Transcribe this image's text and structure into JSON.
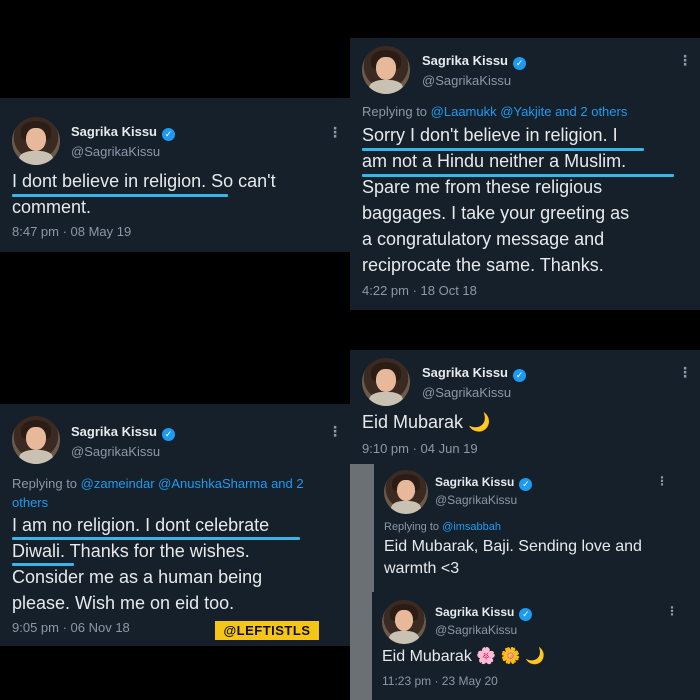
{
  "tweets": [
    {
      "name": "Sagrika Kissu",
      "handle": "@SagrikaKissu",
      "text_lines": [
        "I dont believe in religion. So can't",
        "comment."
      ],
      "meta": "8:47 pm · 08 May 19"
    },
    {
      "name": "Sagrika Kissu",
      "handle": "@SagrikaKissu",
      "replying_prefix": "Replying to ",
      "replying_mentions": "@Laamukk @Yakjite and 2 others",
      "text_lines": [
        "Sorry I don't believe in religion. I",
        "am not a Hindu neither a Muslim.",
        "Spare me from these religious",
        "baggages. I take your greeting as",
        "a congratulatory message and",
        "reciprocate the same. Thanks."
      ],
      "meta": "4:22 pm · 18 Oct 18"
    },
    {
      "name": "Sagrika Kissu",
      "handle": "@SagrikaKissu",
      "replying_prefix": "Replying to ",
      "replying_mentions_line1": "@zameindar @AnushkaSharma and 2",
      "replying_mentions_line2": "others",
      "text_lines": [
        "I am no religion. I dont celebrate",
        "Diwali. Thanks for the wishes.",
        "Consider me as a human being",
        "please. Wish me on eid too."
      ],
      "meta": "9:05 pm · 06 Nov 18"
    },
    {
      "name": "Sagrika Kissu",
      "handle": "@SagrikaKissu",
      "text": "Eid Mubarak",
      "emoji": "🌙",
      "meta": "9:10 pm · 04 Jun 19"
    },
    {
      "name": "Sagrika Kissu",
      "handle": "@SagrikaKissu",
      "replying_prefix": "Replying to ",
      "replying_mentions": "@imsabbah",
      "text_lines": [
        "Eid Mubarak, Baji. Sending love and",
        "warmth <3"
      ]
    },
    {
      "name": "Sagrika Kissu",
      "handle": "@SagrikaKissu",
      "text": "Eid Mubarak",
      "emojis": [
        "🌸",
        "🌼",
        "🌙"
      ],
      "meta": "11:23 pm · 23 May 20"
    }
  ],
  "verified_glyph": "✓",
  "more_glyph": "⋮",
  "watermark": "@LEFTISTLS"
}
